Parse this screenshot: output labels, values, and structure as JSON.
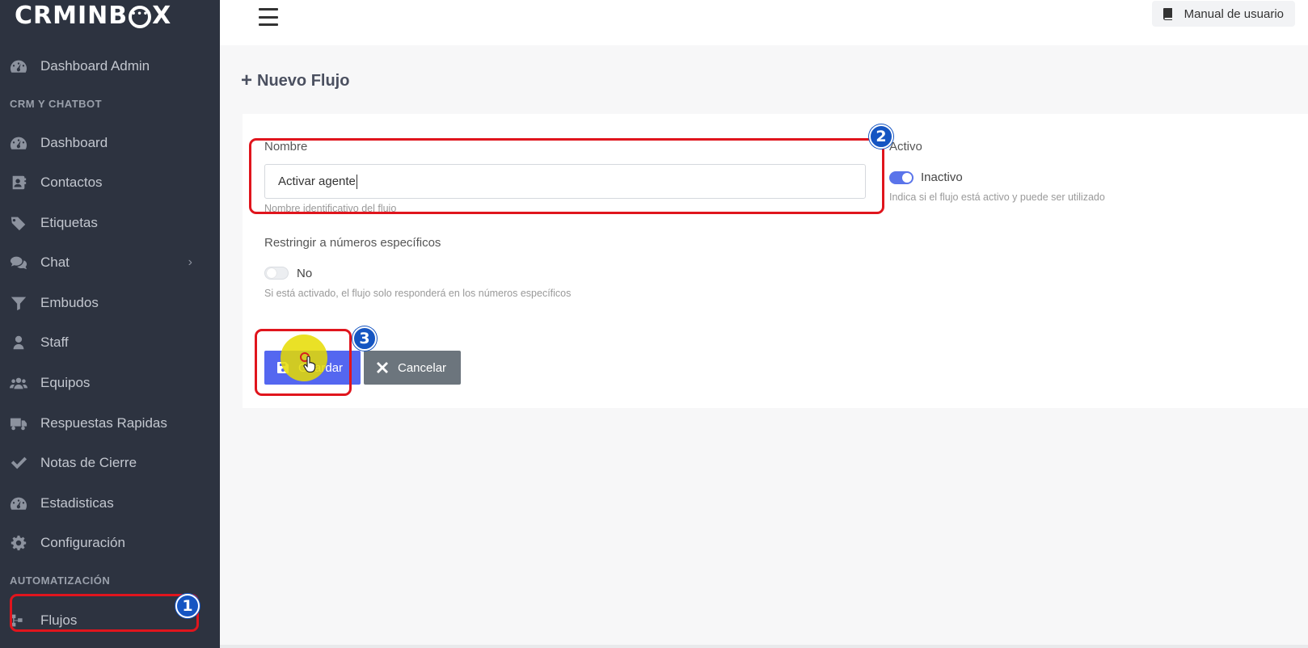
{
  "app": {
    "logo_text_left": "CRMINB",
    "logo_text_right": "X",
    "logo_bubble": "•••"
  },
  "sidebar": {
    "dashboard_admin": "Dashboard Admin",
    "section_crm": "CRM Y CHATBOT",
    "items": [
      {
        "label": "Dashboard",
        "icon": "gauge-icon"
      },
      {
        "label": "Contactos",
        "icon": "contact-card-icon"
      },
      {
        "label": "Etiquetas",
        "icon": "tag-icon"
      },
      {
        "label": "Chat",
        "icon": "comments-icon"
      },
      {
        "label": "Embudos",
        "icon": "funnel-icon"
      },
      {
        "label": "Staff",
        "icon": "user-icon"
      },
      {
        "label": "Equipos",
        "icon": "users-icon"
      },
      {
        "label": "Respuestas Rapidas",
        "icon": "truck-icon"
      },
      {
        "label": "Notas de Cierre",
        "icon": "check-icon"
      },
      {
        "label": "Estadisticas",
        "icon": "gauge-icon"
      },
      {
        "label": "Configuración",
        "icon": "gear-icon"
      }
    ],
    "section_auto": "AUTOMATIZACIÓN",
    "flujos": "Flujos"
  },
  "topbar": {
    "manual_label": "Manual de usuario"
  },
  "page": {
    "title": "Nuevo Flujo"
  },
  "form": {
    "name_label": "Nombre",
    "name_value": "Activar agente",
    "name_help": "Nombre identificativo del flujo",
    "active_label": "Activo",
    "active_toggle_text": "Inactivo",
    "active_help": "Indica si el flujo está activo y puede ser utilizado",
    "restrict_label": "Restringir a números específicos",
    "restrict_toggle_text": "No",
    "restrict_help": "Si está activado, el flujo solo responderá en los números específicos",
    "save_label": "Guardar",
    "cancel_label": "Cancelar"
  },
  "annotations": {
    "step1": "1",
    "step2": "2",
    "step3": "3"
  },
  "colors": {
    "sidebar_bg": "#2d3340",
    "primary": "#5467f0",
    "secondary": "#6c757d",
    "highlight": "#e0151d",
    "badge": "#1555c2"
  }
}
